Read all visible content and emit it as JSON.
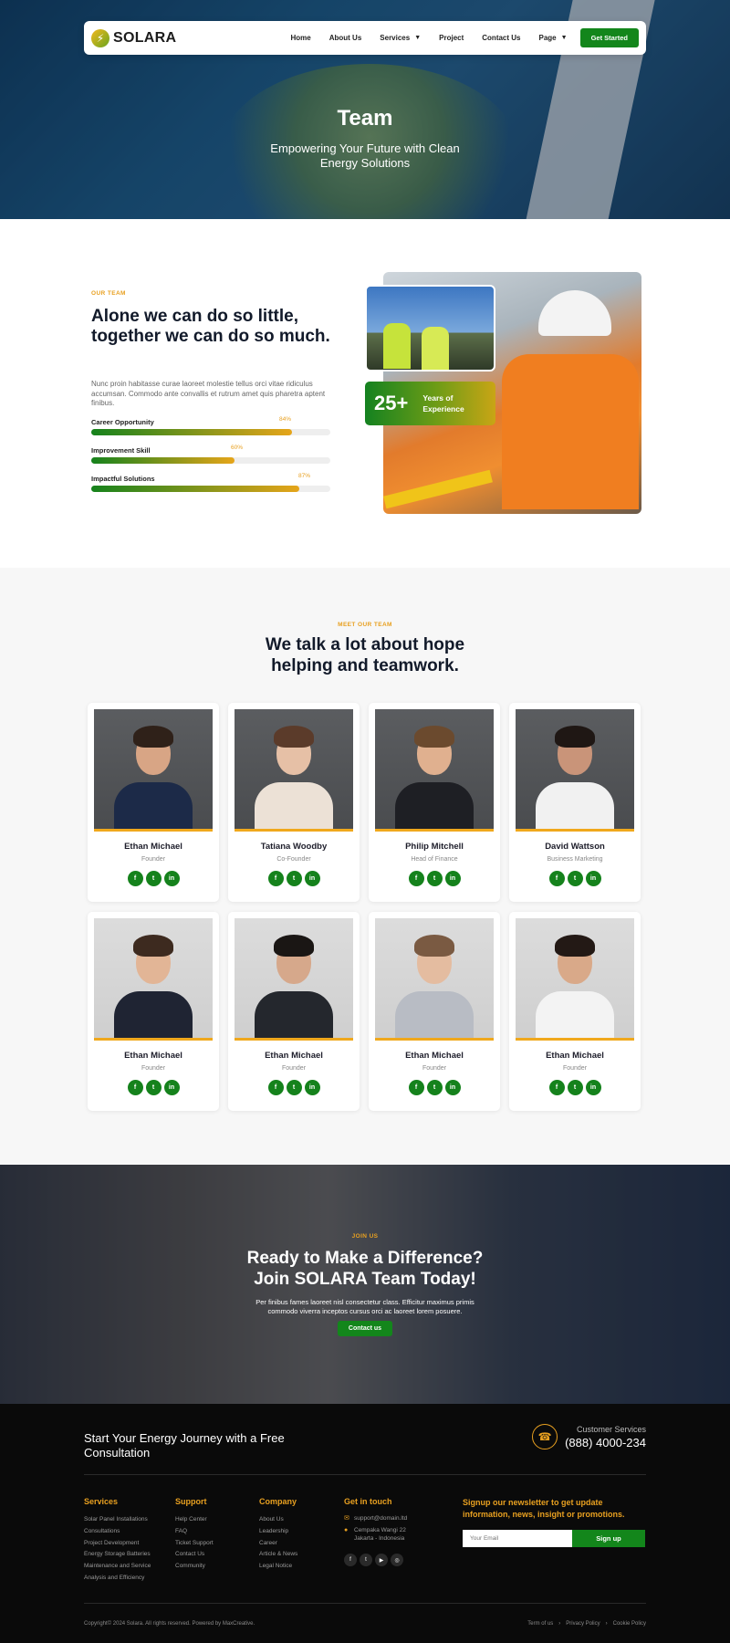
{
  "nav": {
    "logo_mark": "⚡",
    "logo_text": "SOLARA",
    "items": [
      "Home",
      "About Us",
      "Services",
      "Project",
      "Contact Us",
      "Page"
    ],
    "cta": "Get Started"
  },
  "hero": {
    "title": "Team",
    "subtitle_line1": "Empowering Your Future with Clean",
    "subtitle_line2": "Energy Solutions"
  },
  "about": {
    "eyebrow": "OUR TEAM",
    "title": "Alone we can do so little, together we can do so much.",
    "text": "Nunc proin habitasse curae laoreet molestie tellus orci vitae ridiculus accumsan. Commodo ante convallis et rutrum amet quis pharetra aptent finibus.",
    "bars": [
      {
        "label": "Career Opportunity",
        "percent": 84,
        "percent_text": "84%"
      },
      {
        "label": "Improvement Skill",
        "percent": 60,
        "percent_text": "60%"
      },
      {
        "label": "Impactful Solutions",
        "percent": 87,
        "percent_text": "87%"
      }
    ],
    "stat_number": "25+",
    "stat_label": "Years of Experience"
  },
  "team": {
    "eyebrow": "MEET OUR TEAM",
    "title_line1": "We talk a lot about hope",
    "title_line2": "helping and teamwork.",
    "members": [
      {
        "name": "Ethan Michael",
        "role": "Founder"
      },
      {
        "name": "Tatiana Woodby",
        "role": "Co-Founder"
      },
      {
        "name": "Philip Mitchell",
        "role": "Head of Finance"
      },
      {
        "name": "David Wattson",
        "role": "Business Marketing"
      },
      {
        "name": "Ethan Michael",
        "role": "Founder"
      },
      {
        "name": "Ethan Michael",
        "role": "Founder"
      },
      {
        "name": "Ethan Michael",
        "role": "Founder"
      },
      {
        "name": "Ethan Michael",
        "role": "Founder"
      }
    ],
    "social_icons": [
      "f",
      "t",
      "in"
    ]
  },
  "cta": {
    "eyebrow": "JOIN US",
    "title_line1": "Ready to Make a Difference?",
    "title_line2": "Join SOLARA Team Today!",
    "text_line1": "Per finibus fames laoreet nisl consectetur class. Efficitur maximus primis",
    "text_line2": "commodo viverra inceptos cursus orci ac laoreet lorem posuere.",
    "button": "Contact us"
  },
  "footer": {
    "heading_line1": "Start Your Energy Journey with a Free",
    "heading_line2": "Consultation",
    "cs_label": "Customer Services",
    "cs_phone": "(888) 4000-234",
    "services": {
      "title": "Services",
      "links": [
        "Solar Panel Installations",
        "Consultations",
        "Project Development",
        "Energy Storage Batteries",
        "Maintenance and Service",
        "Analysis and Efficiency"
      ]
    },
    "support": {
      "title": "Support",
      "links": [
        "Help Center",
        "FAQ",
        "Ticket Support",
        "Contact Us",
        "Community"
      ]
    },
    "company": {
      "title": "Company",
      "links": [
        "About Us",
        "Leadership",
        "Career",
        "Article & News",
        "Legal Notice"
      ]
    },
    "contact": {
      "title": "Get in touch",
      "email": "support@domain.ltd",
      "address_line1": "Cempaka Wangi 22",
      "address_line2": "Jakarta - Indonesia"
    },
    "newsletter": {
      "title": "Signup our newsletter to get update information, news, insight or promotions.",
      "placeholder": "Your Email",
      "button": "Sign up"
    },
    "copyright": "Copyright© 2024 Solara. All rights reserved. Powered by MaxCreative.",
    "legal": [
      "Term of us",
      "Privacy Policy",
      "Cookie Policy"
    ]
  },
  "colors": {
    "accent_green": "#13861b",
    "accent_orange": "#e8a020",
    "footer_bg": "#0a0a0a"
  }
}
